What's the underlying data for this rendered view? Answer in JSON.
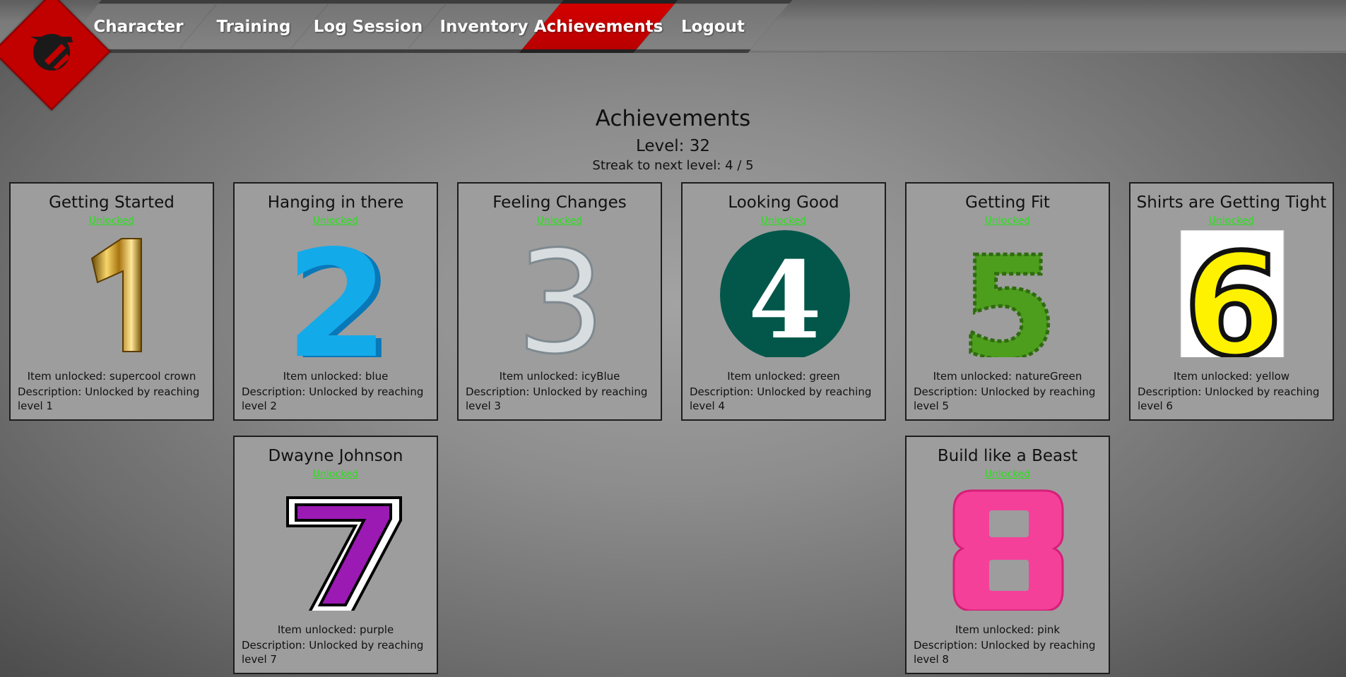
{
  "nav": {
    "tabs": [
      {
        "label": "Character"
      },
      {
        "label": "Training"
      },
      {
        "label": "Log Session"
      },
      {
        "label": "Inventory"
      },
      {
        "label": "Achievements",
        "active": true
      },
      {
        "label": "Logout"
      }
    ]
  },
  "page": {
    "title": "Achievements",
    "level": "Level: 32",
    "streak": "Streak to next level: 4 / 5"
  },
  "achievements": [
    {
      "title": "Getting Started",
      "status": "Unlocked",
      "item": "Item unlocked: supercool crown",
      "description": "Description: Unlocked by reaching level 1",
      "numeral": "1",
      "icon": "gold-numeral-1"
    },
    {
      "title": "Hanging in there",
      "status": "Unlocked",
      "item": "Item unlocked: blue",
      "description": "Description: Unlocked by reaching level 2",
      "numeral": "2",
      "icon": "blue-numeral-2"
    },
    {
      "title": "Feeling Changes",
      "status": "Unlocked",
      "item": "Item unlocked: icyBlue",
      "description": "Description: Unlocked by reaching level 3",
      "numeral": "3",
      "icon": "ice-numeral-3"
    },
    {
      "title": "Looking Good",
      "status": "Unlocked",
      "item": "Item unlocked: green",
      "description": "Description: Unlocked by reaching level 4",
      "numeral": "4",
      "icon": "green-circle-numeral-4"
    },
    {
      "title": "Getting Fit",
      "status": "Unlocked",
      "item": "Item unlocked: natureGreen",
      "description": "Description: Unlocked by reaching level 5",
      "numeral": "5",
      "icon": "leaf-numeral-5"
    },
    {
      "title": "Shirts are Getting Tight",
      "status": "Unlocked",
      "item": "Item unlocked: yellow",
      "description": "Description: Unlocked by reaching level 6",
      "numeral": "6",
      "icon": "yellow-numeral-6"
    },
    {
      "title": "Dwayne Johnson",
      "status": "Unlocked",
      "item": "Item unlocked: purple",
      "description": "Description: Unlocked by reaching level 7",
      "numeral": "7",
      "icon": "purple-numeral-7"
    },
    {
      "title": "Build like a Beast",
      "status": "Unlocked",
      "item": "Item unlocked: pink",
      "description": "Description: Unlocked by reaching level 8",
      "numeral": "8",
      "icon": "pink-numeral-8"
    }
  ],
  "colors": {
    "accent": "#c10000",
    "unlocked": "#29e01a",
    "card_bg": "#9d9d9d"
  }
}
